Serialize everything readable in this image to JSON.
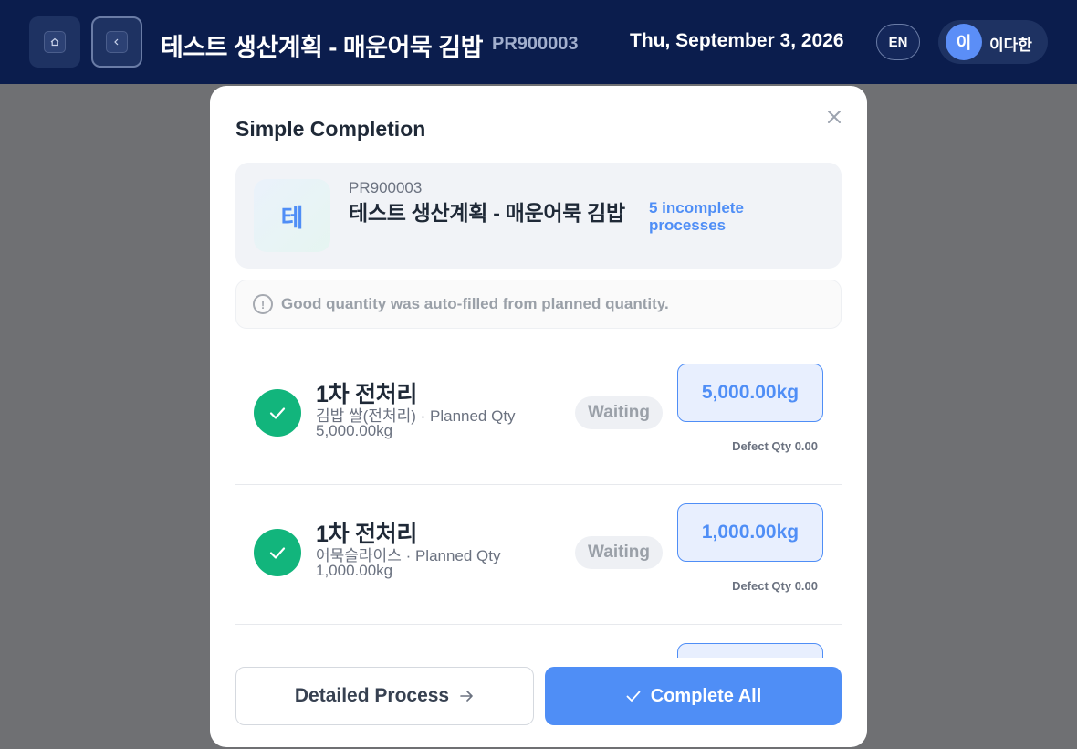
{
  "header": {
    "title": "테스트 생산계획 - 매운어묵 김밥",
    "plan_code": "PR900003",
    "date": "Thu, September 3, 2026",
    "language": "EN",
    "user_initial": "이",
    "user_name": "이다한",
    "icons": {
      "home": "home-icon",
      "back": "chevron-left-icon"
    }
  },
  "modal": {
    "title": "Simple Completion",
    "plan": {
      "icon_letter": "테",
      "code": "PR900003",
      "name": "테스트 생산계획 - 매운어묵 김밥",
      "incomplete": "5 incomplete processes"
    },
    "notice": "Good quantity was auto-filled from planned quantity.",
    "processes": [
      {
        "name": "1차 전처리",
        "desc": "김밥 쌀(전처리) · Planned Qty 5,000.00kg",
        "status": "Waiting",
        "qty": "5,000.00kg",
        "defect": "Defect Qty 0.00"
      },
      {
        "name": "1차 전처리",
        "desc": "어묵슬라이스 · Planned Qty 1,000.00kg",
        "status": "Waiting",
        "qty": "1,000.00kg",
        "defect": "Defect Qty 0.00"
      }
    ],
    "buttons": {
      "detail": "Detailed Process",
      "complete": "Complete All"
    }
  },
  "colors": {
    "header_bg": "#0b1d4d",
    "accent": "#4f8ef6",
    "success": "#12b57c",
    "overlay": "#6f7073"
  }
}
